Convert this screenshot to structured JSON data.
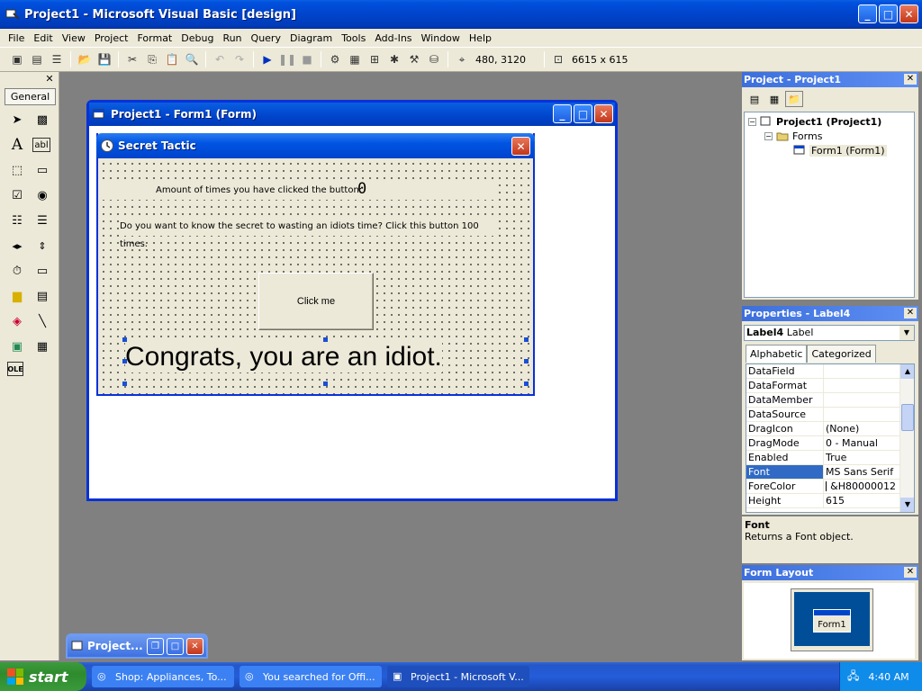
{
  "app": {
    "title": "Project1 - Microsoft Visual Basic [design]"
  },
  "menu": [
    "File",
    "Edit",
    "View",
    "Project",
    "Format",
    "Debug",
    "Run",
    "Query",
    "Diagram",
    "Tools",
    "Add-Ins",
    "Window",
    "Help"
  ],
  "toolbar": {
    "position": "480, 3120",
    "size": "6615 x 615"
  },
  "toolbox": {
    "tab": "General"
  },
  "form_window": {
    "title": "Project1 - Form1 (Form)"
  },
  "inner_form": {
    "title": "Secret Tactic",
    "count_label": "Amount of times you have clicked the button:",
    "count_value": "0",
    "question": "Do you want to know the secret to wasting an idiots time? Click this button 100 times.",
    "button_label": "Click me",
    "big_label": "Congrats, you are an idiot."
  },
  "minimized_window": {
    "title": "Project..."
  },
  "project_panel": {
    "title": "Project - Project1",
    "tree": {
      "root": "Project1 (Project1)",
      "folder": "Forms",
      "item": "Form1 (Form1)"
    }
  },
  "properties_panel": {
    "title": "Properties - Label4",
    "object_name": "Label4",
    "object_type": "Label",
    "tabs": [
      "Alphabetic",
      "Categorized"
    ],
    "rows": [
      {
        "name": "DataField",
        "value": ""
      },
      {
        "name": "DataFormat",
        "value": ""
      },
      {
        "name": "DataMember",
        "value": ""
      },
      {
        "name": "DataSource",
        "value": ""
      },
      {
        "name": "DragIcon",
        "value": "(None)"
      },
      {
        "name": "DragMode",
        "value": "0 - Manual"
      },
      {
        "name": "Enabled",
        "value": "True"
      },
      {
        "name": "Font",
        "value": "MS Sans Serif"
      },
      {
        "name": "ForeColor",
        "value": "&H80000012"
      },
      {
        "name": "Height",
        "value": "615"
      }
    ],
    "selected": "Font",
    "forecolor_swatch": "#000000"
  },
  "description": {
    "title": "Font",
    "text": "Returns a Font object."
  },
  "form_layout": {
    "title": "Form Layout",
    "form_label": "Form1"
  },
  "taskbar": {
    "start": "start",
    "tasks": [
      {
        "label": "Shop: Appliances, To..."
      },
      {
        "label": "You searched for Offi..."
      },
      {
        "label": "Project1 - Microsoft V..."
      }
    ],
    "clock": "4:40 AM"
  },
  "colors": {
    "titlebar": "#0044cc",
    "face": "#ece9d8",
    "mdi_bg": "#808080",
    "selection": "#316ac5"
  }
}
